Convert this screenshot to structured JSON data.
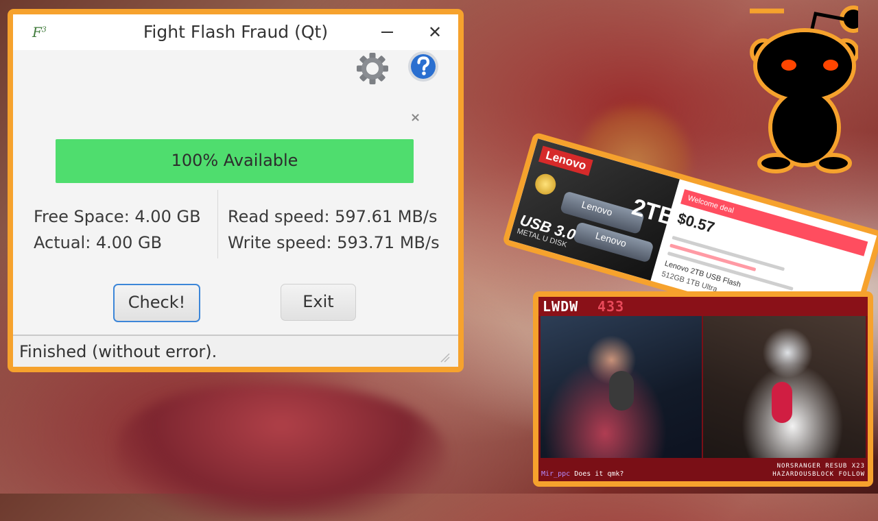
{
  "app": {
    "logo": "F",
    "logo_sup": "3",
    "title": "Fight Flash Fraud (Qt)",
    "minimize_glyph": "",
    "close_glyph": "✕",
    "close_small_glyph": "×",
    "icons": [
      "settings-gear-icon",
      "help-icon"
    ]
  },
  "progress": {
    "label": "100% Available",
    "value": 1.0,
    "color": "#4fdd6e"
  },
  "stats": {
    "free_space": "Free Space: 4.00 GB",
    "actual": "Actual: 4.00 GB",
    "read_speed": "Read speed: 597.61 MB/s",
    "write_speed": "Write speed: 593.71 MB/s"
  },
  "buttons": {
    "check": "Check!",
    "exit": "Exit"
  },
  "status": "Finished (without error).",
  "product": {
    "brand": "Lenovo",
    "capacity": "2TB",
    "usb": "USB 3.0",
    "sub": "METAL U DISK",
    "drive_label": "Lenovo",
    "deal": "Welcome deal",
    "price": "$0.57",
    "title": "Lenovo 2TB USB Flash",
    "title2": "512GB 1TB Ultra",
    "accent": "#d62a2a"
  },
  "stream": {
    "show": "LWDW",
    "episode": "433",
    "chat_user": "Mir_ppc",
    "chat_msg": "Does it qmk?",
    "alert1": "NORSRANGER RESUB X23",
    "alert2": "HAZARDOUSBLOCK FOLLOW"
  },
  "colors": {
    "frame": "#f6a22d",
    "check_focus": "#3c86d8",
    "stream_bg": "#7a0f16"
  }
}
